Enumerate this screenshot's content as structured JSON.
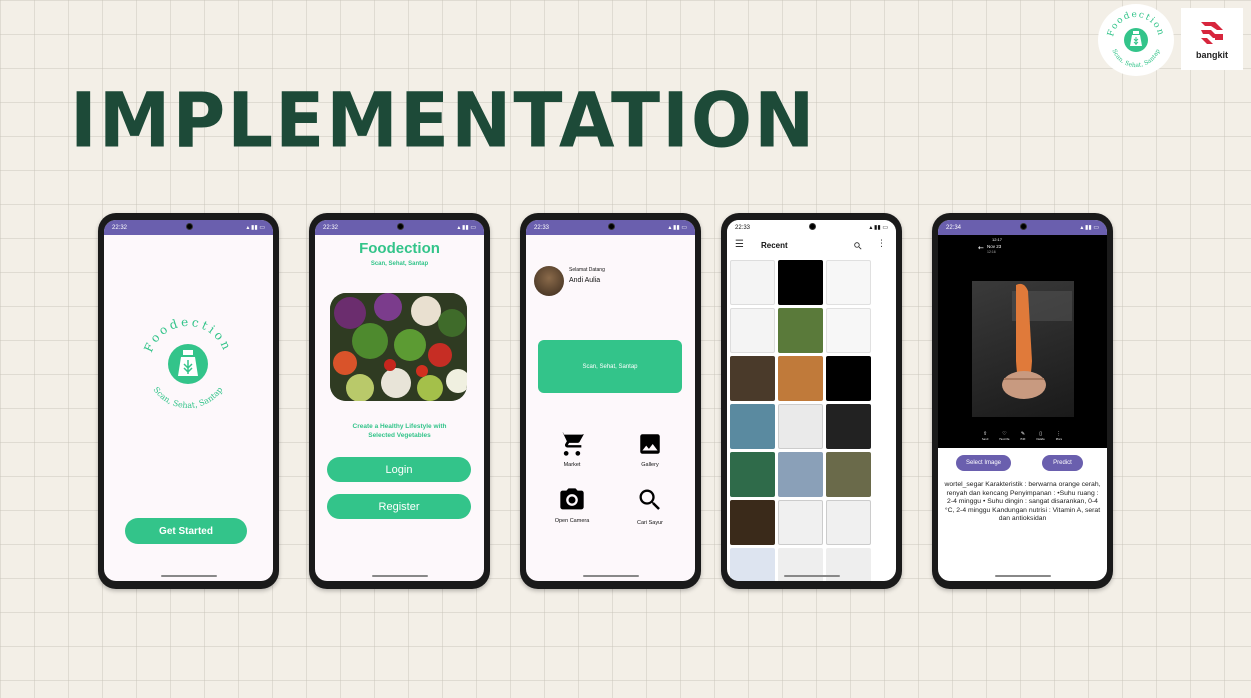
{
  "headline": "IMPLEMENTATION",
  "logos": {
    "foodection_ring": "Foodection",
    "foodection_tagline": "Scan, Sehat, Santap",
    "bangkit": "bangkit"
  },
  "phone1": {
    "time": "22:32",
    "brand_ring": "Foodection",
    "brand_tagline": "Scan, Sehat, Santap",
    "cta": "Get Started"
  },
  "phone2": {
    "time": "22:32",
    "title": "Foodection",
    "subtitle": "Scan, Sehat, Santap",
    "desc_line1": "Create a Healthy Lifestyle with",
    "desc_line2": "Selected Vegetables",
    "login": "Login",
    "register": "Register"
  },
  "phone3": {
    "time": "22:33",
    "greeting": "Selamat Datang",
    "user": "Andi Aulia",
    "banner": "Scan, Sehat, Santap",
    "menu": [
      {
        "label": "Market"
      },
      {
        "label": "Gallery"
      },
      {
        "label": "Open Camera"
      },
      {
        "label": "Cari Sayur"
      }
    ]
  },
  "phone4": {
    "time": "22:33",
    "title": "Recent"
  },
  "phone5": {
    "time": "22:34",
    "inner_time": "12:17",
    "date": "Nov 23",
    "date_sub": "12:16",
    "actions": [
      "Send",
      "Favorite",
      "Edit",
      "Delete",
      "More"
    ],
    "select_image": "Select Image",
    "predict": "Predict",
    "result": "wortel_segar Karakteristik : berwarna orange cerah, renyah dan kencang Penyimpanan : •Suhu ruang : 2-4 minggu • Suhu dingin : sangat disarankan, 0-4 °C, 2-4 minggu Kandungan nutrisi : Vitamin A, serat dan antioksidan"
  },
  "colors": {
    "brand_green": "#33c48a",
    "heading_green": "#1d4a38",
    "purple": "#6a5fae"
  }
}
